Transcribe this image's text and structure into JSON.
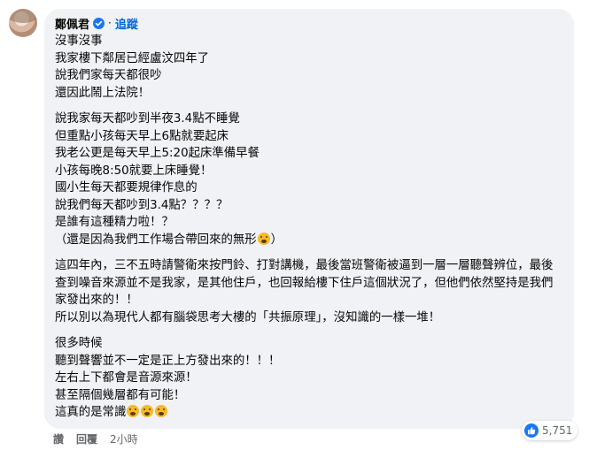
{
  "comment": {
    "author": "鄭佩君",
    "follow_label": "追蹤",
    "dot": "·",
    "paragraphs": [
      [
        "沒事沒事",
        "我家樓下鄰居已經盧汶四年了",
        "說我們家每天都很吵",
        "還因此鬧上法院！"
      ],
      [
        "說我家每天都吵到半夜3.4點不睡覺",
        "但重點小孩每天早上6點就要起床",
        "我老公更是每天早上5:20起床準備早餐",
        "小孩每晚8:50就要上床睡覺！",
        "國小生每天都要規律作息的",
        "說我們每天都吵到3.4點？？？？",
        "是誰有這種精力啦！？",
        "（還是因為我們工作場合帶回來的無形",
        "）"
      ],
      [
        "這四年內，三不五時請警衛來按門鈴、打對講機，最後當班警衛被逼到一層一層聽聲辨位，最後查到噪音來源並不是我家，是其他住戶，也回報給樓下住戶這個狀況了，但他們依然堅持是我們家發出來的！！",
        "所以別以為現代人都有腦袋思考大樓的「共振原理」，沒知識的一樣一堆！"
      ],
      [
        "很多時候",
        "聽到聲響並不一定是正上方發出來的！！！",
        "左右上下都會是音源來源！",
        "甚至隔個幾層都有可能！",
        "這真的是常識"
      ]
    ],
    "actions": {
      "like": "讚",
      "reply": "回覆",
      "time": "2小時"
    },
    "reaction_count": "5,751",
    "colors": {
      "bubble": "#f0f2f5",
      "link": "#0064d1",
      "verified": "#1877f2",
      "like": "#1877f2"
    },
    "emojis": {
      "thinking": "thinking-face",
      "yawning": "yawning-face"
    }
  }
}
